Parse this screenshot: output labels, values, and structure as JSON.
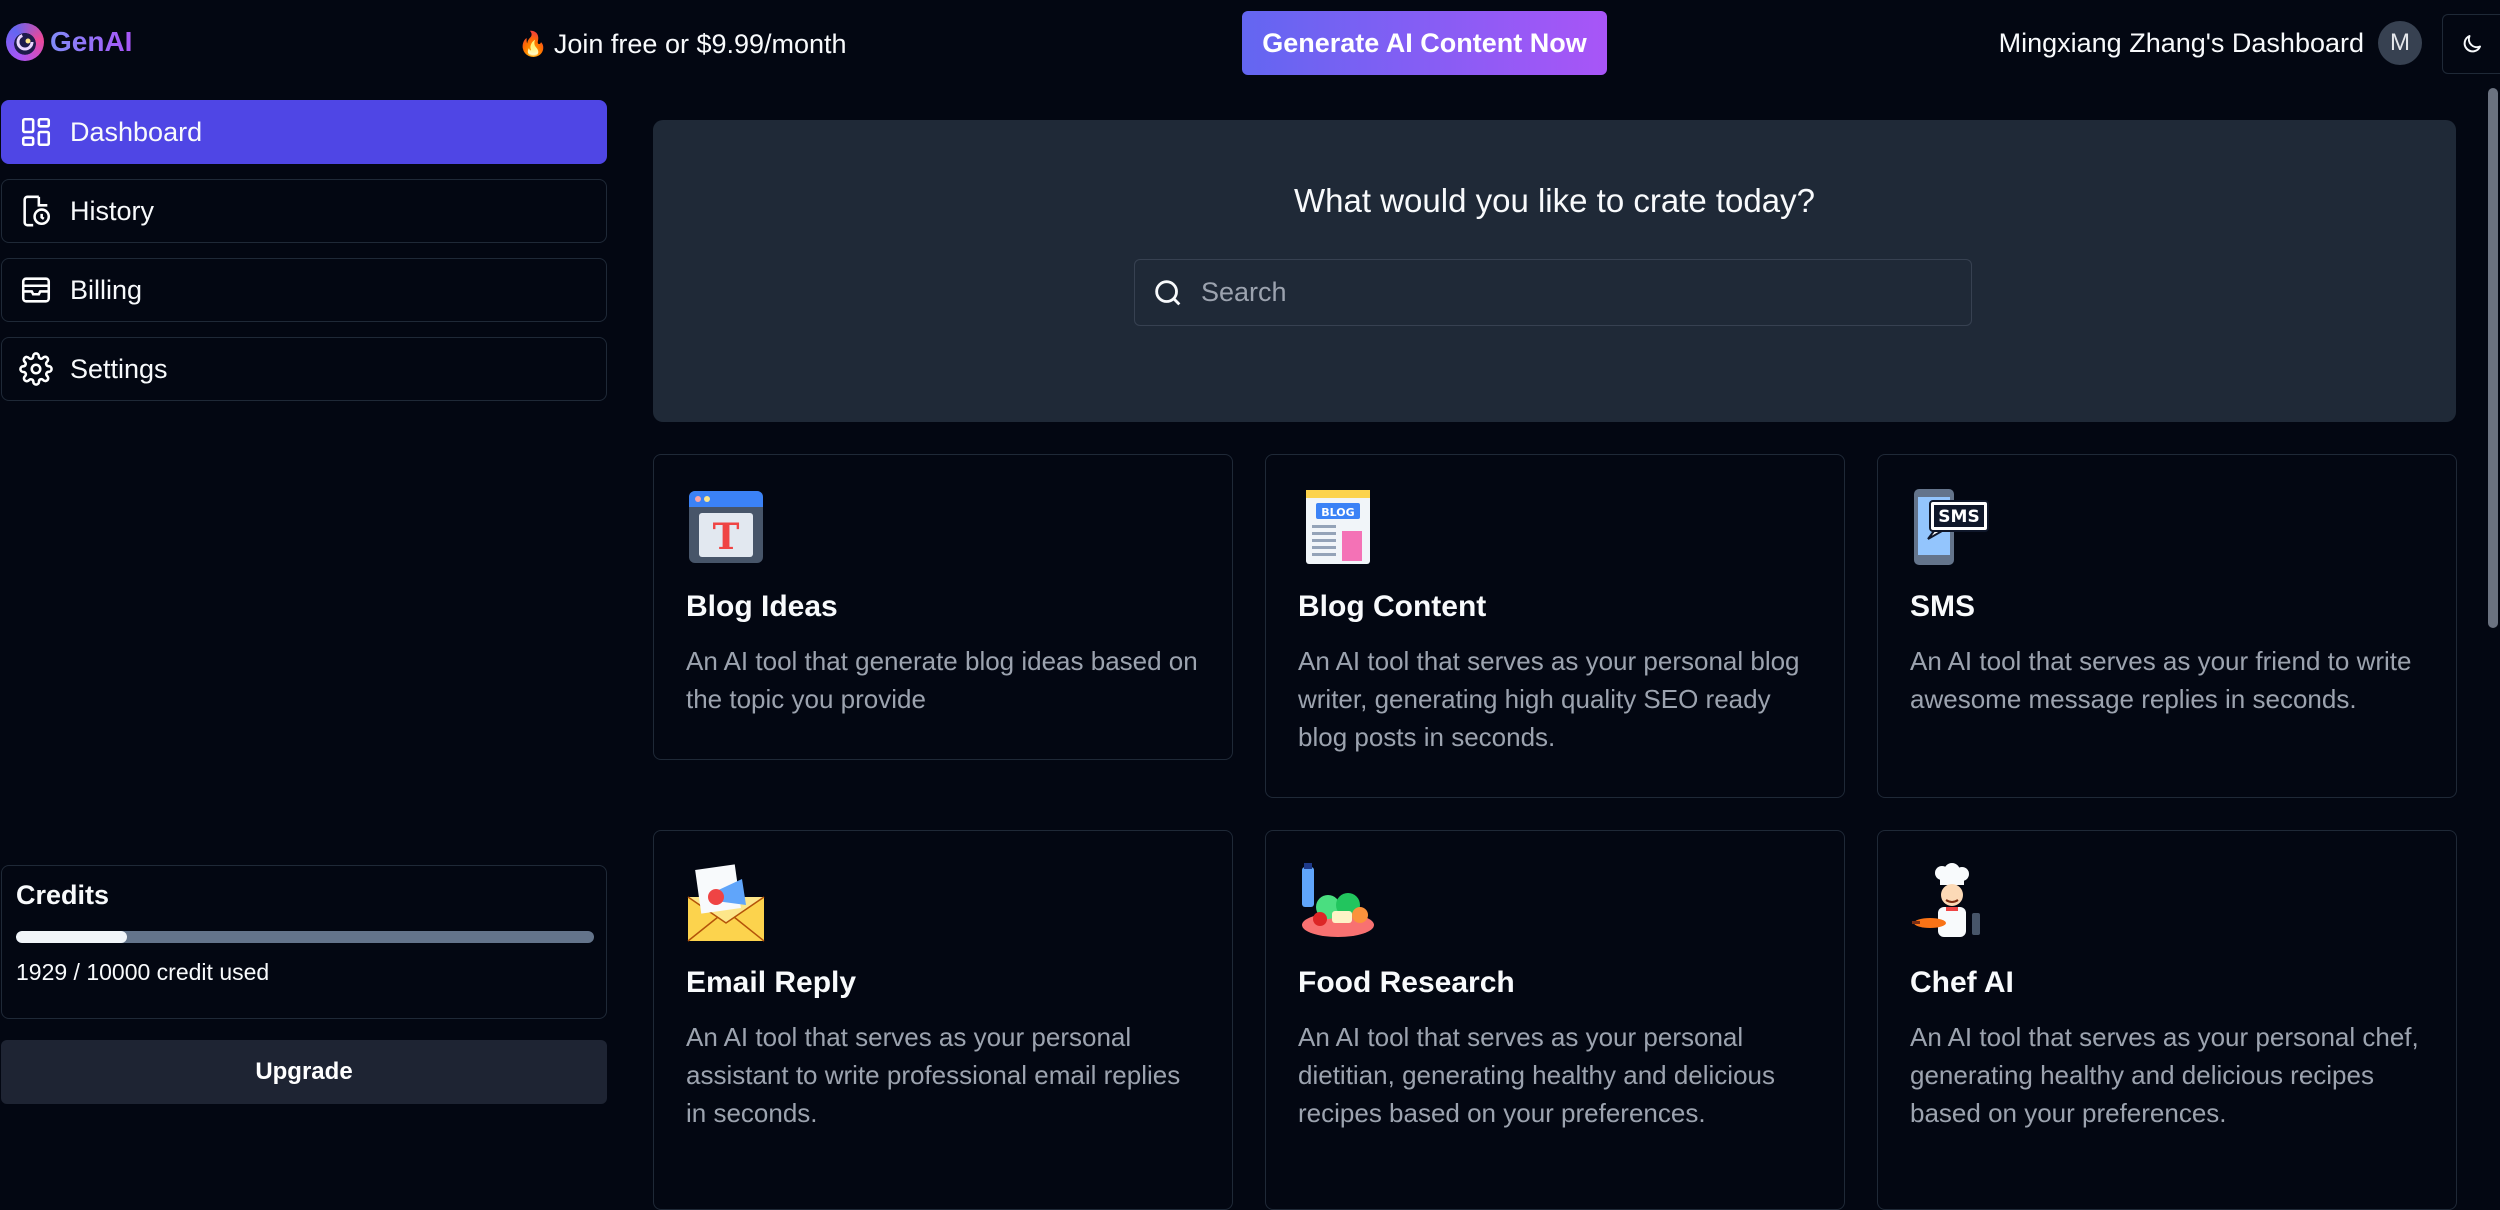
{
  "header": {
    "brand": "GenAI",
    "promo_icon": "flame-icon",
    "promo": "Join free or $9.99/month",
    "cta": "Generate AI Content Now",
    "user_title": "Mingxiang Zhang's Dashboard",
    "avatar_initial": "M",
    "theme_icon": "moon-icon"
  },
  "sidebar": {
    "items": [
      {
        "label": "Dashboard",
        "icon": "dashboard-icon",
        "active": true
      },
      {
        "label": "History",
        "icon": "history-icon",
        "active": false
      },
      {
        "label": "Billing",
        "icon": "billing-icon",
        "active": false
      },
      {
        "label": "Settings",
        "icon": "settings-icon",
        "active": false
      }
    ],
    "credits": {
      "title": "Credits",
      "used": 1929,
      "total": 10000,
      "text": "1929 / 10000 credit used"
    },
    "upgrade": "Upgrade"
  },
  "main": {
    "hero_title": "What would you like to crate today?",
    "search_placeholder": "Search",
    "cards": [
      {
        "title": "Blog Ideas",
        "icon": "blog-ideas-icon",
        "desc": "An AI tool that generate blog ideas based on the topic you provide"
      },
      {
        "title": "Blog Content",
        "icon": "blog-content-icon",
        "desc": "An AI tool that serves as your personal blog writer, generating high quality SEO ready blog posts in seconds."
      },
      {
        "title": "SMS",
        "icon": "sms-icon",
        "desc": "An AI tool that serves as your friend to write awesome message replies in seconds."
      },
      {
        "title": "Email Reply",
        "icon": "email-reply-icon",
        "desc": "An AI tool that serves as your personal assistant to write professional email replies in seconds."
      },
      {
        "title": "Food Research",
        "icon": "food-research-icon",
        "desc": "An AI tool that serves as your personal dietitian, generating healthy and delicious recipes based on your preferences."
      },
      {
        "title": "Chef AI",
        "icon": "chef-icon",
        "desc": "An AI tool that serves as your personal chef, generating healthy and delicious recipes based on your preferences."
      }
    ],
    "icon_labels": {
      "blog_ideas": "T",
      "blog_content": "BLOG",
      "sms": "SMS"
    }
  },
  "colors": {
    "background": "#030712",
    "accent": "#4f46e5",
    "cta_start": "#6366f1",
    "cta_end": "#a855f7",
    "panel": "#1f2937"
  }
}
